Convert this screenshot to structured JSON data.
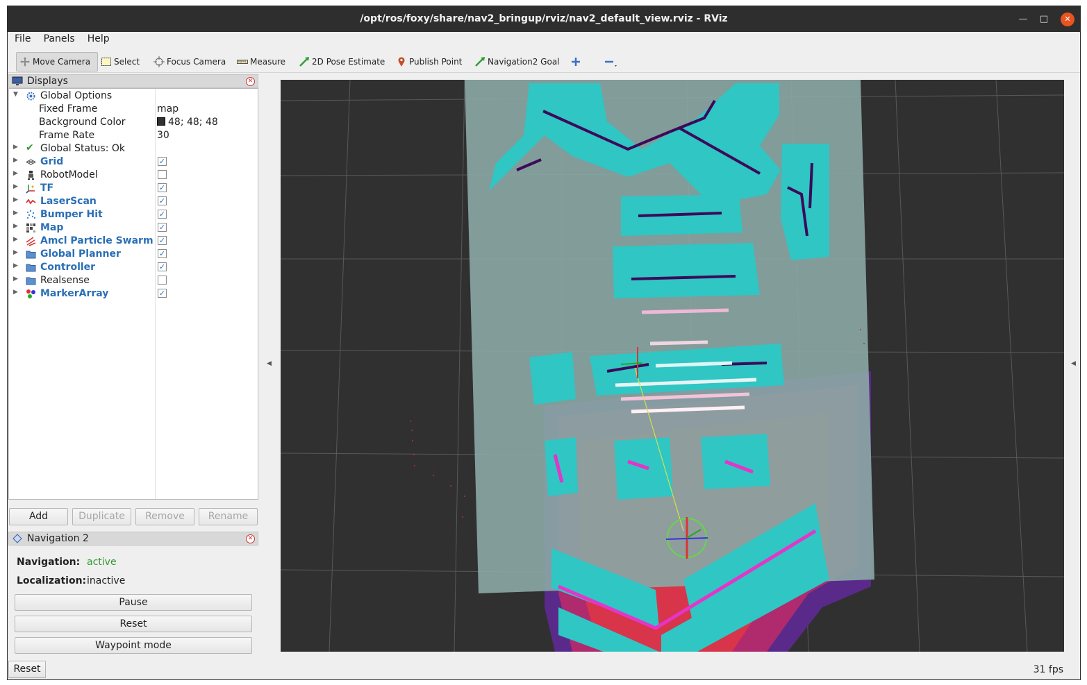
{
  "window": {
    "title": "/opt/ros/foxy/share/nav2_bringup/rviz/nav2_default_view.rviz - RViz"
  },
  "menu": {
    "file": "File",
    "panels": "Panels",
    "help": "Help"
  },
  "toolbar": {
    "move_camera": "Move Camera",
    "select": "Select",
    "focus_camera": "Focus Camera",
    "measure": "Measure",
    "pose_estimate": "2D Pose Estimate",
    "publish_point": "Publish Point",
    "nav_goal": "Navigation2 Goal"
  },
  "displays": {
    "title": "Displays",
    "global_options": "Global Options",
    "fixed_frame_label": "Fixed Frame",
    "fixed_frame_value": "map",
    "bg_color_label": "Background Color",
    "bg_color_value": "48; 48; 48",
    "frame_rate_label": "Frame Rate",
    "frame_rate_value": "30",
    "global_status": "Global Status: Ok",
    "items": [
      {
        "label": "Grid",
        "checked": true
      },
      {
        "label": "RobotModel",
        "checked": false
      },
      {
        "label": "TF",
        "checked": true
      },
      {
        "label": "LaserScan",
        "checked": true
      },
      {
        "label": "Bumper Hit",
        "checked": true
      },
      {
        "label": "Map",
        "checked": true
      },
      {
        "label": "Amcl Particle Swarm",
        "checked": true
      },
      {
        "label": "Global Planner",
        "checked": true
      },
      {
        "label": "Controller",
        "checked": true
      },
      {
        "label": "Realsense",
        "checked": false
      },
      {
        "label": "MarkerArray",
        "checked": true
      }
    ],
    "buttons": {
      "add": "Add",
      "duplicate": "Duplicate",
      "remove": "Remove",
      "rename": "Rename"
    }
  },
  "navigation": {
    "title": "Navigation 2",
    "nav_label": "Navigation:",
    "nav_value": "active",
    "loc_label": "Localization:",
    "loc_value": "inactive",
    "pause": "Pause",
    "reset": "Reset",
    "waypoint": "Waypoint mode"
  },
  "status": {
    "reset": "Reset",
    "fps": "31 fps"
  },
  "colors": {
    "accent": "#2a6fb6",
    "background": "#303030",
    "costmap_cyan": "#2fd6d6",
    "status_green": "#2f9a2f"
  }
}
